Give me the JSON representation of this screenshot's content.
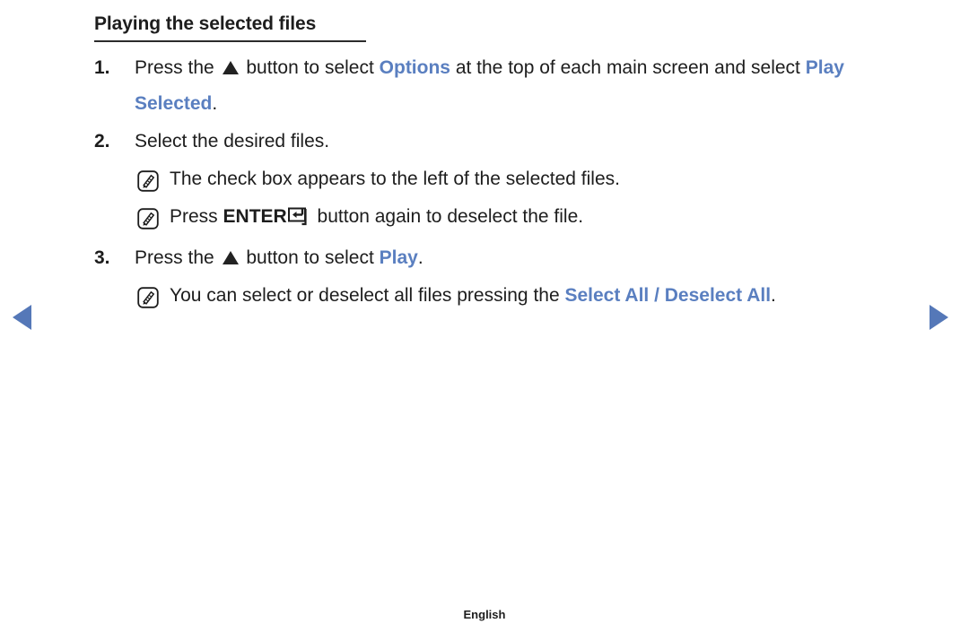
{
  "page": {
    "heading": "Playing the selected files",
    "footer_language": "English",
    "accent_color": "#5a7fc0",
    "arrow_color": "#5578b8",
    "text_color": "#1d1d1d",
    "background": "#ffffff"
  },
  "steps": [
    {
      "number": "1.",
      "parts": [
        {
          "type": "text",
          "value": "Press the "
        },
        {
          "type": "icon",
          "value": "up-triangle"
        },
        {
          "type": "text",
          "value": " button to select "
        },
        {
          "type": "accent",
          "value": "Options"
        },
        {
          "type": "text",
          "value": " at the top of each main screen and select "
        },
        {
          "type": "accent",
          "value": "Play Selected"
        },
        {
          "type": "text",
          "value": "."
        }
      ],
      "plain": "Press the ▲ button to select Options at the top of each main screen and select Play Selected."
    },
    {
      "number": "2.",
      "parts": [
        {
          "type": "text",
          "value": "Select the desired files."
        }
      ],
      "plain": "Select the desired files."
    },
    {
      "number": "3.",
      "parts": [
        {
          "type": "text",
          "value": "Press the "
        },
        {
          "type": "icon",
          "value": "up-triangle"
        },
        {
          "type": "text",
          "value": " button to select "
        },
        {
          "type": "accent",
          "value": "Play"
        },
        {
          "type": "text",
          "value": "."
        }
      ],
      "plain": "Press the ▲ button to select Play."
    }
  ],
  "notes": [
    {
      "id": "note-checkbox",
      "icon": "note-pencil-icon",
      "after_step": "2.",
      "plain": "The check box appears to the left of the selected files.",
      "parts": [
        {
          "type": "text",
          "value": "The check box appears to the left of the selected files."
        }
      ]
    },
    {
      "id": "note-enter",
      "icon": "note-pencil-icon",
      "after_step": "2.",
      "plain": "Press ENTER⏎ button again to deselect the file.",
      "parts": [
        {
          "type": "text",
          "value": "Press "
        },
        {
          "type": "strong",
          "value": "ENTER"
        },
        {
          "type": "icon",
          "value": "enter-key"
        },
        {
          "type": "text",
          "value": " button again to deselect the file."
        }
      ]
    },
    {
      "id": "note-select-all",
      "icon": "note-pencil-icon",
      "after_step": "3.",
      "plain": "You can select or deselect all files pressing the Select All / Deselect All.",
      "parts": [
        {
          "type": "text",
          "value": "You can select or deselect all files pressing the "
        },
        {
          "type": "accent",
          "value": "Select All / Deselect All"
        },
        {
          "type": "text",
          "value": "."
        }
      ]
    }
  ],
  "navigation": {
    "prev_label": "previous-page",
    "next_label": "next-page"
  }
}
